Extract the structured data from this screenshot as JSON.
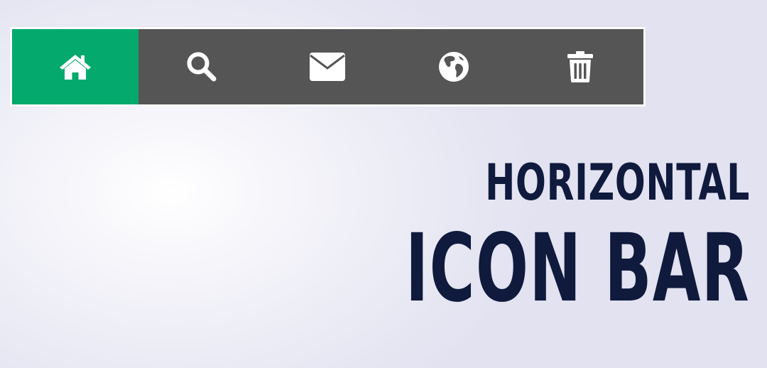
{
  "icon_bar": {
    "items": [
      {
        "icon": "home-icon",
        "active": true
      },
      {
        "icon": "search-icon",
        "active": false
      },
      {
        "icon": "envelope-icon",
        "active": false
      },
      {
        "icon": "globe-icon",
        "active": false
      },
      {
        "icon": "trash-icon",
        "active": false
      }
    ]
  },
  "headline": {
    "line1": "HORIZONTAL",
    "line2": "ICON BAR"
  },
  "colors": {
    "bar_background": "#555555",
    "active_item": "#04aa6d",
    "icon": "#ffffff",
    "headline_text": "#0f1a3d"
  }
}
